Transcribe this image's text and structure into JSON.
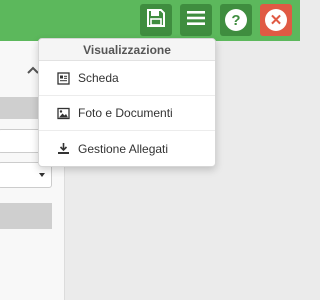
{
  "colors": {
    "topbar": "#5cb85c",
    "button_green": "#3f8d3f",
    "button_red": "#e05a44"
  },
  "toolbar": {
    "buttons": [
      {
        "icon": "save-icon"
      },
      {
        "icon": "menu-icon"
      },
      {
        "icon": "help-icon",
        "glyph": "?"
      },
      {
        "icon": "close-icon",
        "glyph": "✕"
      }
    ]
  },
  "menu": {
    "header": "Visualizzazione",
    "items": [
      {
        "label": "Scheda",
        "icon": "card-icon"
      },
      {
        "label": "Foto e Documenti",
        "icon": "image-icon"
      },
      {
        "label": "Gestione Allegati",
        "icon": "download-icon"
      }
    ]
  },
  "left_panel": {
    "collapse_icon": "chevron-up-icon"
  }
}
